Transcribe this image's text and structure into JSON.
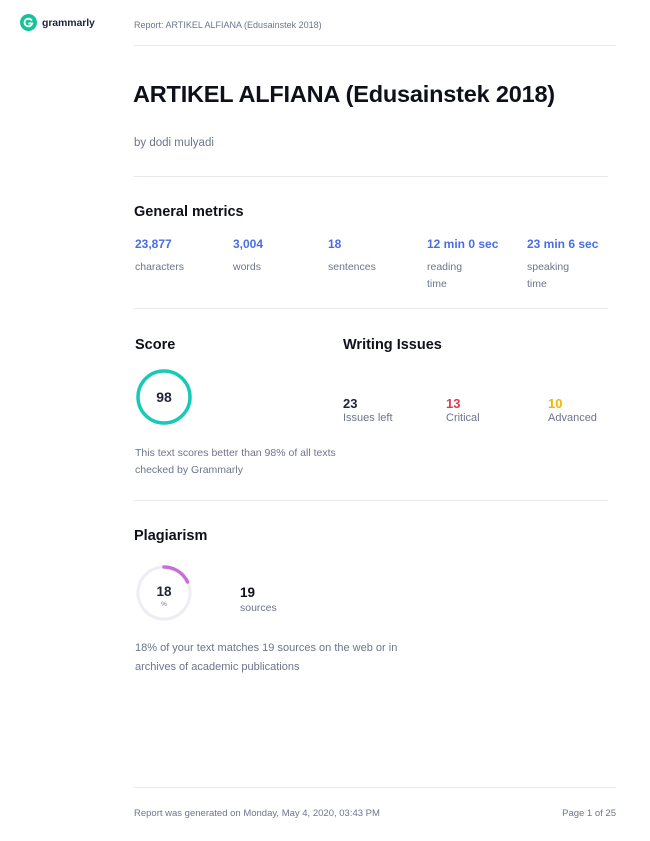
{
  "brand": {
    "name": "grammarly",
    "accent": "#15c39a"
  },
  "header": {
    "report_title": "Report: ARTIKEL ALFIANA (Edusainstek 2018)"
  },
  "document": {
    "title": "ARTIKEL ALFIANA (Edusainstek 2018)",
    "author": "by dodi mulyadi"
  },
  "general_metrics": {
    "title": "General metrics",
    "items": [
      {
        "value": "23,877",
        "label": "characters"
      },
      {
        "value": "3,004",
        "label": "words"
      },
      {
        "value": "18",
        "label": "sentences"
      },
      {
        "value": "12 min 0 sec",
        "label": "reading time"
      },
      {
        "value": "23 min 6 sec",
        "label": "speaking time"
      }
    ]
  },
  "score": {
    "title": "Score",
    "value": "98",
    "description": "This text scores better than 98% of all texts checked by Grammarly",
    "ring_color": "#16c9b8"
  },
  "writing_issues": {
    "title": "Writing Issues",
    "items": [
      {
        "value": "23",
        "label": "Issues left",
        "color": "#1f243c"
      },
      {
        "value": "13",
        "label": "Critical",
        "color": "#e03a53"
      },
      {
        "value": "10",
        "label": "Advanced",
        "color": "#f4b400"
      }
    ]
  },
  "plagiarism": {
    "title": "Plagiarism",
    "percent": "18",
    "percent_unit": "%",
    "sources_count": "19",
    "sources_label": "sources",
    "description": "18% of your text matches 19 sources on the web or in archives of academic publications",
    "ring_color": "#c86fd6"
  },
  "footer": {
    "generated": "Report was generated on Monday, May 4, 2020, 03:43 PM",
    "page": "Page 1 of 25"
  }
}
